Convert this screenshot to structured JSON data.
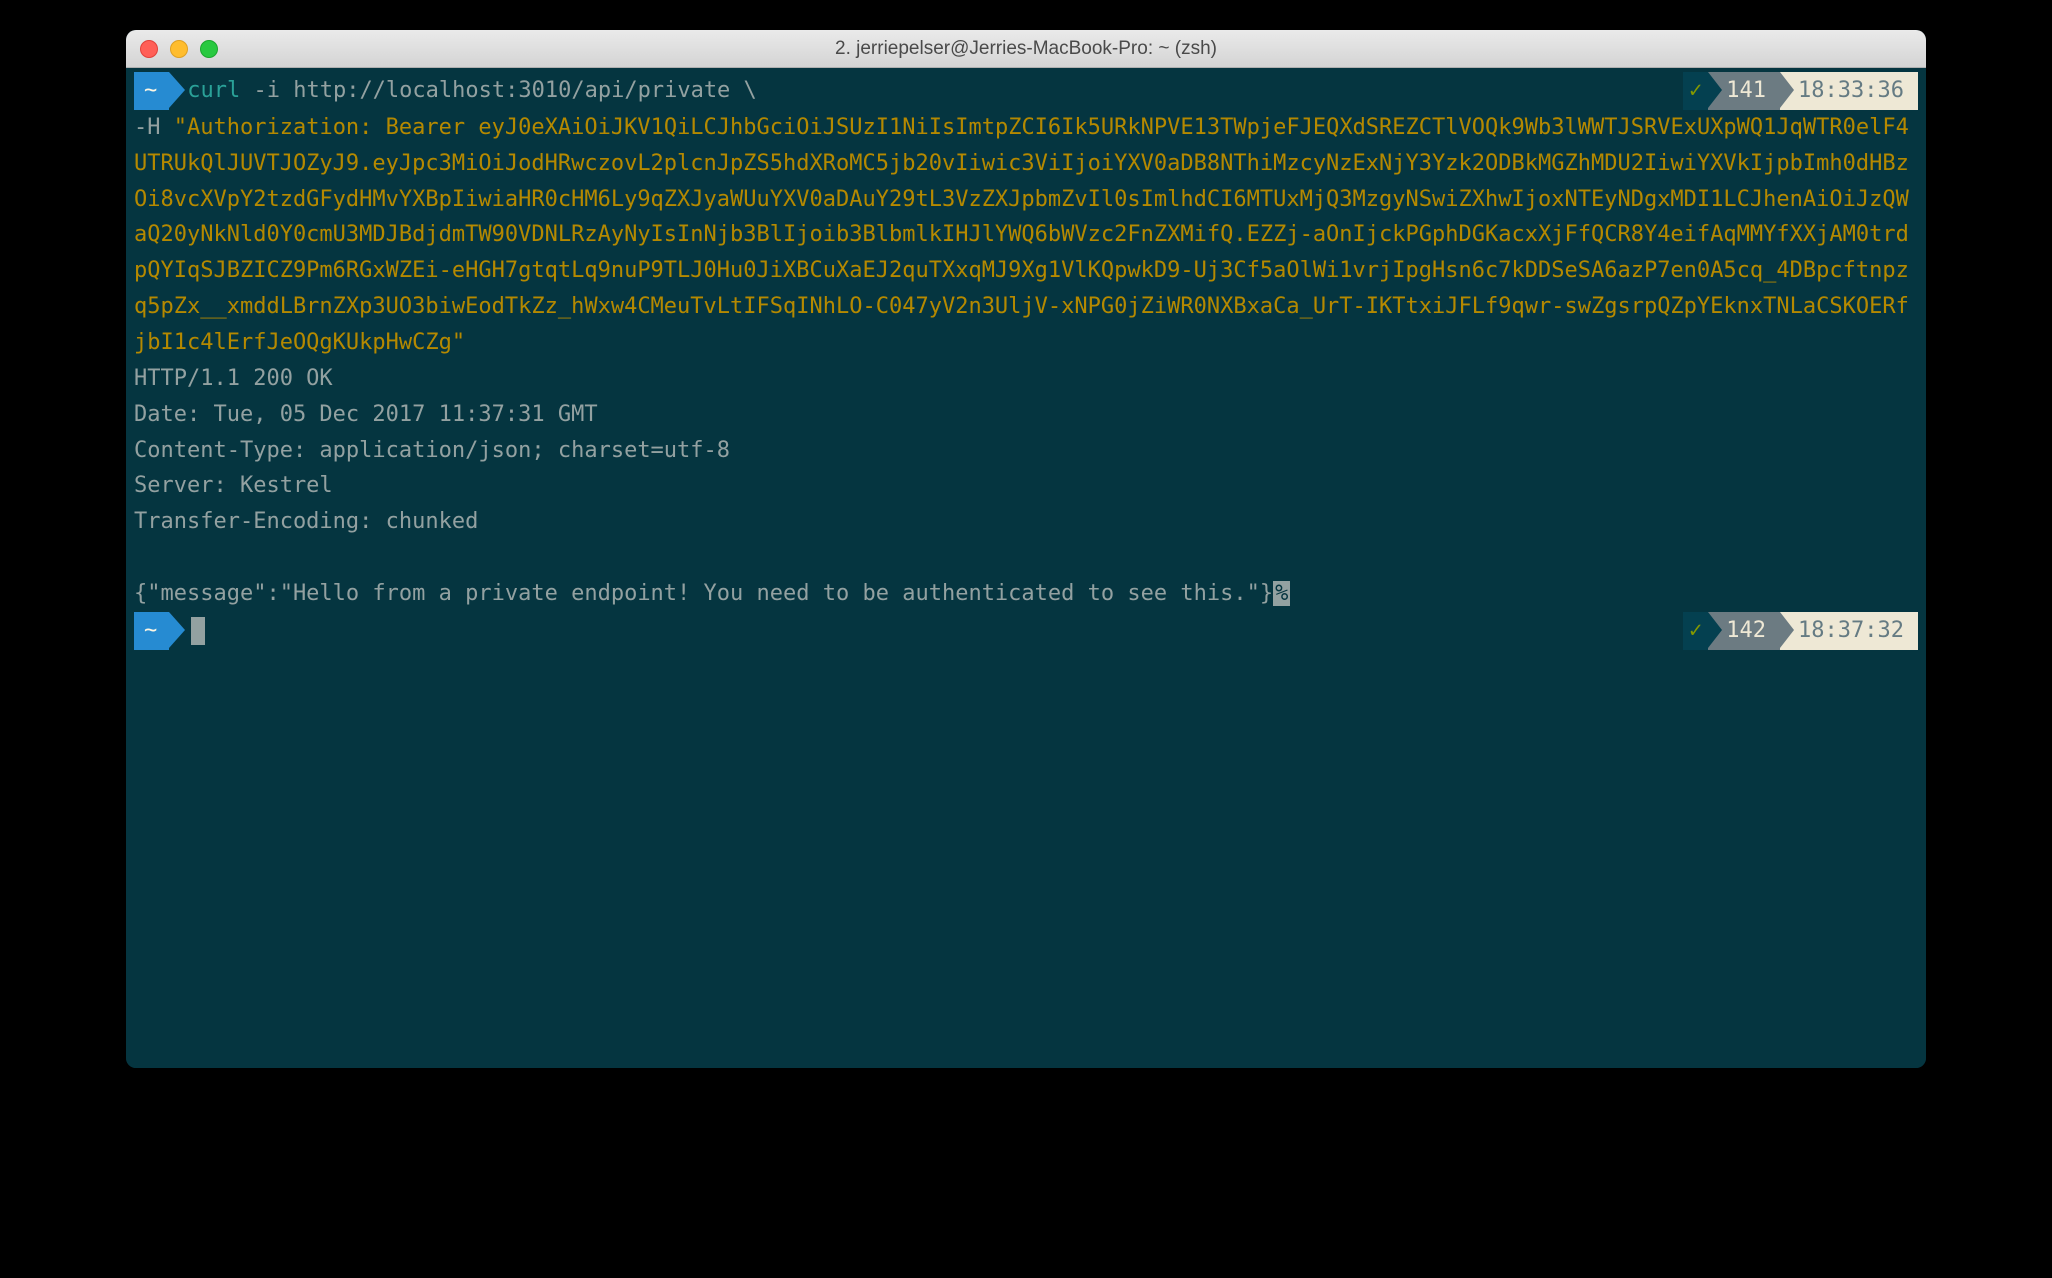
{
  "window": {
    "title": "2. jerriepelser@Jerries-MacBook-Pro: ~ (zsh)"
  },
  "prompt1": {
    "home": "~",
    "cmd_name": "curl",
    "cmd_rest": " -i http://localhost:3010/api/private \\",
    "status_check": "✓",
    "status_num": "141",
    "status_time": "18:33:36"
  },
  "cont": {
    "prefix": "-H ",
    "token": "\"Authorization: Bearer eyJ0eXAiOiJKV1QiLCJhbGciOiJSUzI1NiIsImtpZCI6Ik5URkNPVE13TWpjeFJEQXdSREZCTlVOQk9Wb3lWWTJSRVExUXpWQ1JqWTR0elF4UTRUkQlJUVTJOZyJ9.eyJpc3MiOiJodHRwczovL2plcnJpZS5hdXRoMC5jb20vIiwic3ViIjoiYXV0aDB8NThiMzcyNzExNjY3Yzk2ODBkMGZhMDU2IiwiYXVkIjpbImh0dHBzOi8vcXVpY2tzdGFydHMvYXBpIiwiaHR0cHM6Ly9qZXJyaWUuYXV0aDAuY29tL3VzZXJpbmZvIl0sImlhdCI6MTUxMjQ3MzgyNSwiZXhwIjoxNTEyNDgxMDI1LCJhenAiOiJzQWaQ20yNkNld0Y0cmU3MDJBdjdmTW90VDNLRzAyNyIsInNjb3BlIjoib3BlbmlkIHJlYWQ6bWVzc2FnZXMifQ.EZZj-aOnIjckPGphDGKacxXjFfQCR8Y4eifAqMMYfXXjAM0trdpQYIqSJBZICZ9Pm6RGxWZEi-eHGH7gtqtLq9nuP9TLJ0Hu0JiXBCuXaEJ2quTXxqMJ9Xg1VlKQpwkD9-Uj3Cf5aOlWi1vrjIpgHsn6c7kDDSeSA6azP7en0A5cq_4DBpcftnpzq5pZx__xmddLBrnZXp3UO3biwEodTkZz_hWxw4CMeuTvLtIFSqINhLO-C047yV2n3UljV-xNPG0jZiWR0NXBxaCa_UrT-IKTtxiJFLf9qwr-swZgsrpQZpYEknxTNLaCSKOERfjbI1c4lErfJeOQgKUkpHwCZg\""
  },
  "response": {
    "status_line": "HTTP/1.1 200 OK",
    "date": "Date: Tue, 05 Dec 2017 11:37:31 GMT",
    "content_type": "Content-Type: application/json; charset=utf-8",
    "server": "Server: Kestrel",
    "transfer": "Transfer-Encoding: chunked",
    "body": "{\"message\":\"Hello from a private endpoint! You need to be authenticated to see this.\"}",
    "trailing": "%"
  },
  "prompt2": {
    "home": "~",
    "status_check": "✓",
    "status_num": "142",
    "status_time": "18:37:32"
  }
}
